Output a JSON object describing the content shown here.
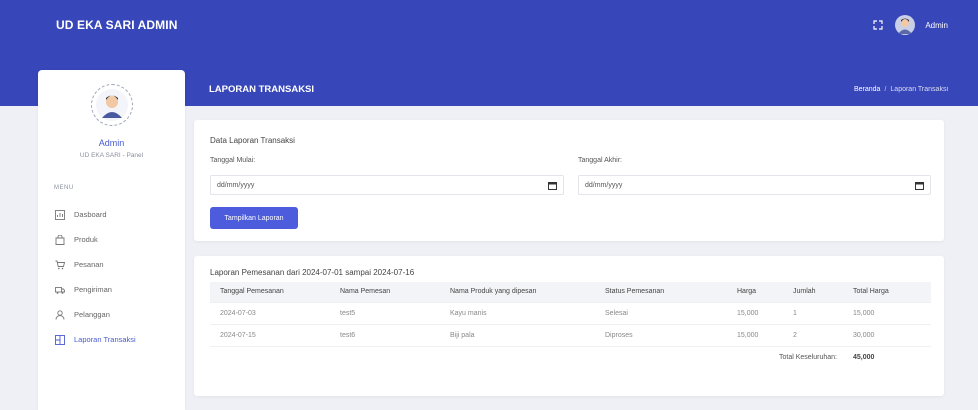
{
  "app": {
    "brand": "UD EKA SARI ADMIN",
    "user_label": "Admin"
  },
  "header": {
    "title": "LAPORAN TRANSAKSI",
    "breadcrumb": {
      "home": "Beranda",
      "separator": "/",
      "current": "Laporan Transaksi"
    }
  },
  "sidebar": {
    "profile_name": "Admin",
    "profile_subtitle": "UD EKA SARI - Panel",
    "menu_header": "MENU",
    "items": [
      {
        "label": "Dasboard",
        "icon": "dashboard-icon"
      },
      {
        "label": "Produk",
        "icon": "bag-icon"
      },
      {
        "label": "Pesanan",
        "icon": "cart-icon"
      },
      {
        "label": "Pengiriman",
        "icon": "truck-icon"
      },
      {
        "label": "Pelanggan",
        "icon": "user-icon"
      },
      {
        "label": "Laporan Transaksi",
        "icon": "report-icon",
        "active": true
      }
    ]
  },
  "filter": {
    "title": "Data Laporan Transaksi",
    "start_label": "Tanggal Mulai:",
    "start_value": "dd/mm/yyyy",
    "end_label": "Tanggal Akhir:",
    "end_value": "dd/mm/yyyy",
    "submit_label": "Tampilkan Laporan"
  },
  "report": {
    "title": "Laporan Pemesanan dari 2024-07-01 sampai 2024-07-16",
    "columns": [
      "Tanggal Pemesanan",
      "Nama Pemesan",
      "Nama Produk yang dipesan",
      "Status Pemesanan",
      "Harga",
      "Jumlah",
      "Total Harga"
    ],
    "rows": [
      [
        "2024-07-03",
        "test5",
        "Kayu manis",
        "Selesai",
        "15,000",
        "1",
        "15,000"
      ],
      [
        "2024-07-15",
        "test6",
        "Biji pala",
        "Diproses",
        "15,000",
        "2",
        "30,000"
      ]
    ],
    "total_label": "Total Keseluruhan:",
    "total_value": "45,000"
  },
  "colors": {
    "primary": "#3746b8",
    "button": "#4d5cdc",
    "accent_text": "#4a5bd0",
    "background": "#eef0f6"
  }
}
